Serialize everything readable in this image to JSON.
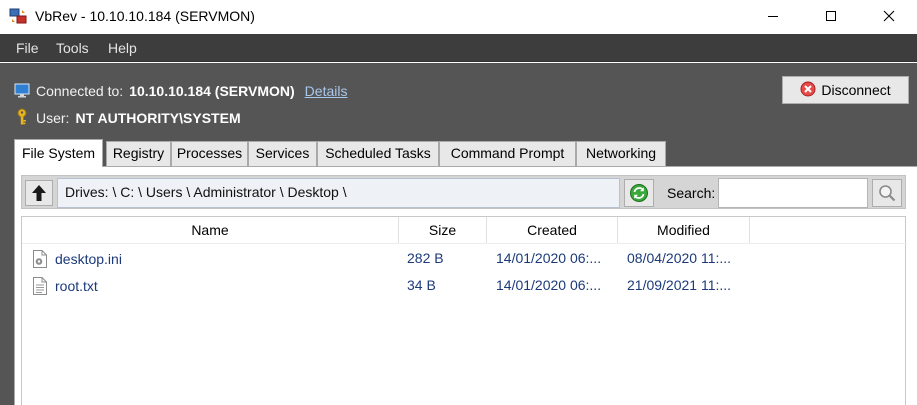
{
  "window": {
    "title": "VbRev - 10.10.10.184 (SERVMON)",
    "icon": "app-icon"
  },
  "menu": {
    "items": [
      "File",
      "Tools",
      "Help"
    ]
  },
  "connection": {
    "label": "Connected to:",
    "value": "10.10.10.184 (SERVMON)",
    "details_link": "Details"
  },
  "user": {
    "label": "User:",
    "value": "NT AUTHORITY\\SYSTEM"
  },
  "disconnect_button": "Disconnect",
  "tabs": [
    {
      "label": "File System",
      "active": true
    },
    {
      "label": "Registry",
      "active": false
    },
    {
      "label": "Processes",
      "active": false
    },
    {
      "label": "Services",
      "active": false
    },
    {
      "label": "Scheduled Tasks",
      "active": false
    },
    {
      "label": "Command Prompt",
      "active": false
    },
    {
      "label": "Networking",
      "active": false
    }
  ],
  "filesystem": {
    "path": "Drives:  \\  C:  \\  Users  \\  Administrator  \\  Desktop  \\",
    "search_label": "Search:",
    "search_value": "",
    "columns": [
      "Name",
      "Size",
      "Created",
      "Modified"
    ],
    "files": [
      {
        "name": "desktop.ini",
        "icon": "settings-file-icon",
        "size": "282 B",
        "created": "14/01/2020 06:...",
        "modified": "08/04/2020 11:..."
      },
      {
        "name": "root.txt",
        "icon": "text-file-icon",
        "size": "34 B",
        "created": "14/01/2020 06:...",
        "modified": "21/09/2021 11:..."
      }
    ]
  },
  "colors": {
    "menubar": "#3d3d3d",
    "panel": "#555555",
    "link": "#a8c8ec",
    "file_text": "#1c3a7a"
  }
}
